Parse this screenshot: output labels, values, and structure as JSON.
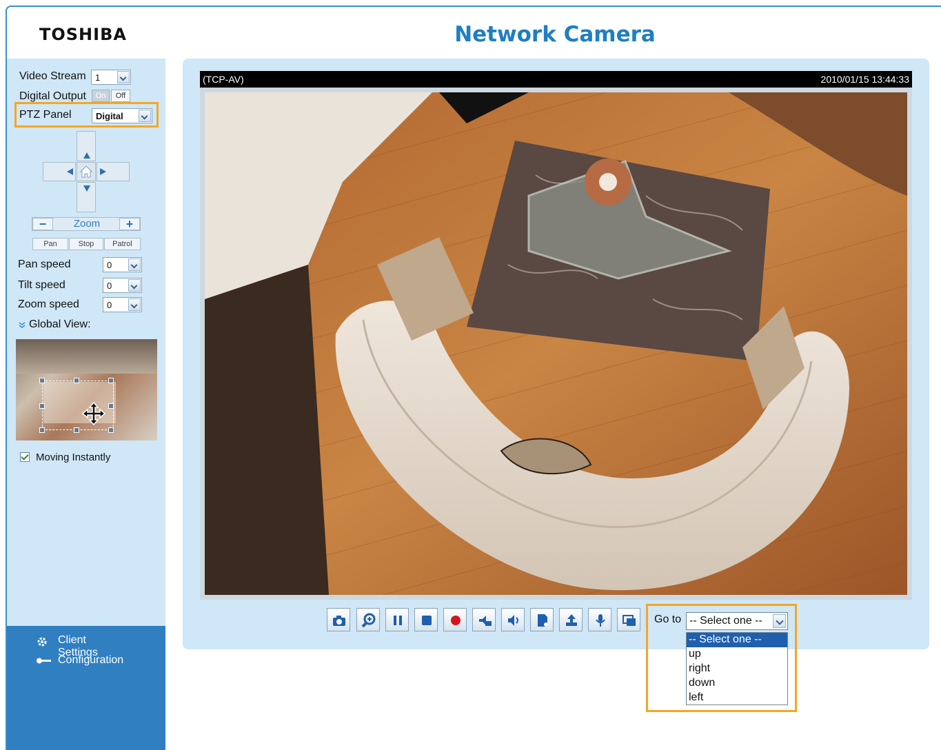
{
  "header": {
    "logo": "TOSHIBA",
    "title": "Network Camera"
  },
  "left": {
    "video_stream": {
      "label": "Video Stream",
      "value": "1"
    },
    "digital_output": {
      "label": "Digital Output",
      "on": "On",
      "off": "Off"
    },
    "ptz_panel": {
      "label": "PTZ Panel",
      "value": "Digital"
    },
    "zoom": {
      "minus": "−",
      "label": "Zoom",
      "plus": "+"
    },
    "buttons": {
      "pan": "Pan",
      "stop": "Stop",
      "patrol": "Patrol"
    },
    "pan_speed": {
      "label": "Pan speed",
      "value": "0"
    },
    "tilt_speed": {
      "label": "Tilt speed",
      "value": "0"
    },
    "zoom_speed": {
      "label": "Zoom speed",
      "value": "0"
    },
    "global_view": {
      "label": "Global View:"
    },
    "moving_instantly": {
      "label": "Moving Instantly",
      "checked": true
    }
  },
  "footer": {
    "client_settings": "Client Settings",
    "configuration": "Configuration"
  },
  "video": {
    "mode": "(TCP-AV)",
    "timestamp": "2010/01/15 13:44:33"
  },
  "toolbar": {
    "icons": [
      "camera-icon",
      "zoom-icon",
      "pause-icon",
      "stop-icon",
      "record-icon",
      "speaker-mute-icon",
      "volume-icon",
      "talk-icon",
      "upload-icon",
      "microphone-icon",
      "fullscreen-icon"
    ]
  },
  "goto": {
    "label": "Go to",
    "selected": "-- Select one --",
    "options": [
      "-- Select one --",
      "up",
      "right",
      "down",
      "left"
    ]
  },
  "colors": {
    "accent": "#1f7ec2",
    "panel": "#cfe7f7",
    "highlight": "#f5a623",
    "footer": "#2f7fc1"
  }
}
